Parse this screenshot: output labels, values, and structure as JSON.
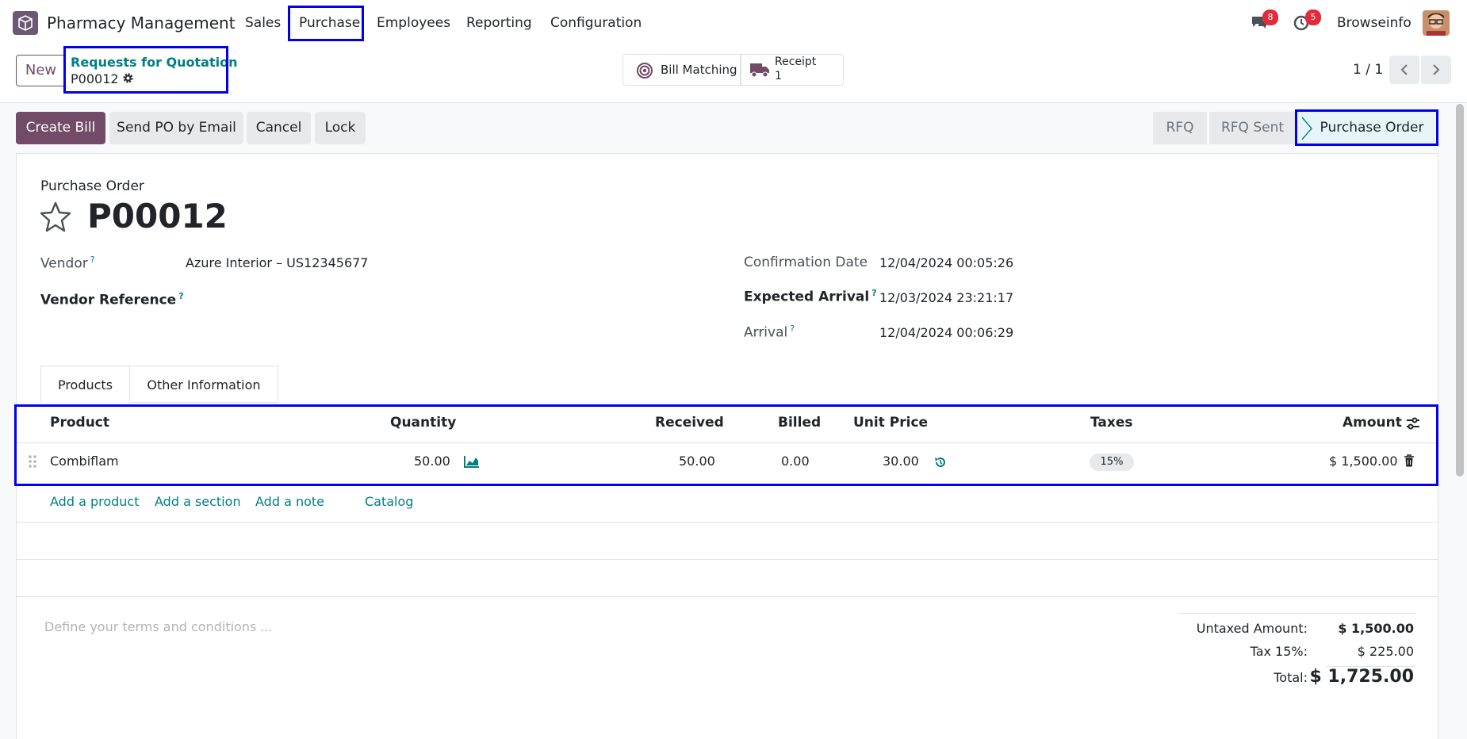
{
  "navbar": {
    "app_name": "Pharmacy Management",
    "menus": [
      "Sales",
      "Purchase",
      "Employees",
      "Reporting",
      "Configuration"
    ],
    "messages_count": "8",
    "activities_count": "5",
    "user_name": "Browseinfo"
  },
  "control": {
    "new_label": "New",
    "breadcrumb_parent": "Requests for Quotation",
    "breadcrumb_current": "P00012",
    "bill_matching_label": "Bill Matching",
    "receipt_label": "Receipt",
    "receipt_count": "1",
    "pager": "1 / 1"
  },
  "actions": {
    "create_bill": "Create Bill",
    "send_po": "Send PO by Email",
    "cancel": "Cancel",
    "lock": "Lock"
  },
  "statusbar": [
    "RFQ",
    "RFQ Sent",
    "Purchase Order"
  ],
  "form": {
    "subtitle": "Purchase Order",
    "name": "P00012",
    "vendor_label": "Vendor",
    "vendor_value": "Azure Interior – US12345677",
    "vendor_ref_label": "Vendor Reference",
    "confirmation_label": "Confirmation Date",
    "confirmation_value": "12/04/2024 00:05:26",
    "expected_label": "Expected Arrival",
    "expected_value": "12/03/2024 23:21:17",
    "arrival_label": "Arrival",
    "arrival_value": "12/04/2024 00:06:29"
  },
  "tabs": [
    "Products",
    "Other Information"
  ],
  "table": {
    "headers": {
      "product": "Product",
      "quantity": "Quantity",
      "received": "Received",
      "billed": "Billed",
      "unit_price": "Unit Price",
      "taxes": "Taxes",
      "amount": "Amount"
    },
    "row": {
      "product": "Combiflam",
      "quantity": "50.00",
      "received": "50.00",
      "billed": "0.00",
      "unit_price": "30.00",
      "taxes": "15%",
      "amount": "$ 1,500.00"
    }
  },
  "add_links": [
    "Add a product",
    "Add a section",
    "Add a note",
    "Catalog"
  ],
  "terms_placeholder": "Define your terms and conditions ...",
  "totals": {
    "untaxed_label": "Untaxed Amount:",
    "untaxed_value": "$ 1,500.00",
    "tax_label": "Tax 15%:",
    "tax_value": "$ 225.00",
    "total_label": "Total:",
    "total_value": "$ 1,725.00"
  },
  "colors": {
    "brand": "#714b67",
    "link": "#017e84",
    "highlight": "#0000ee",
    "badge": "#e02b3b"
  }
}
